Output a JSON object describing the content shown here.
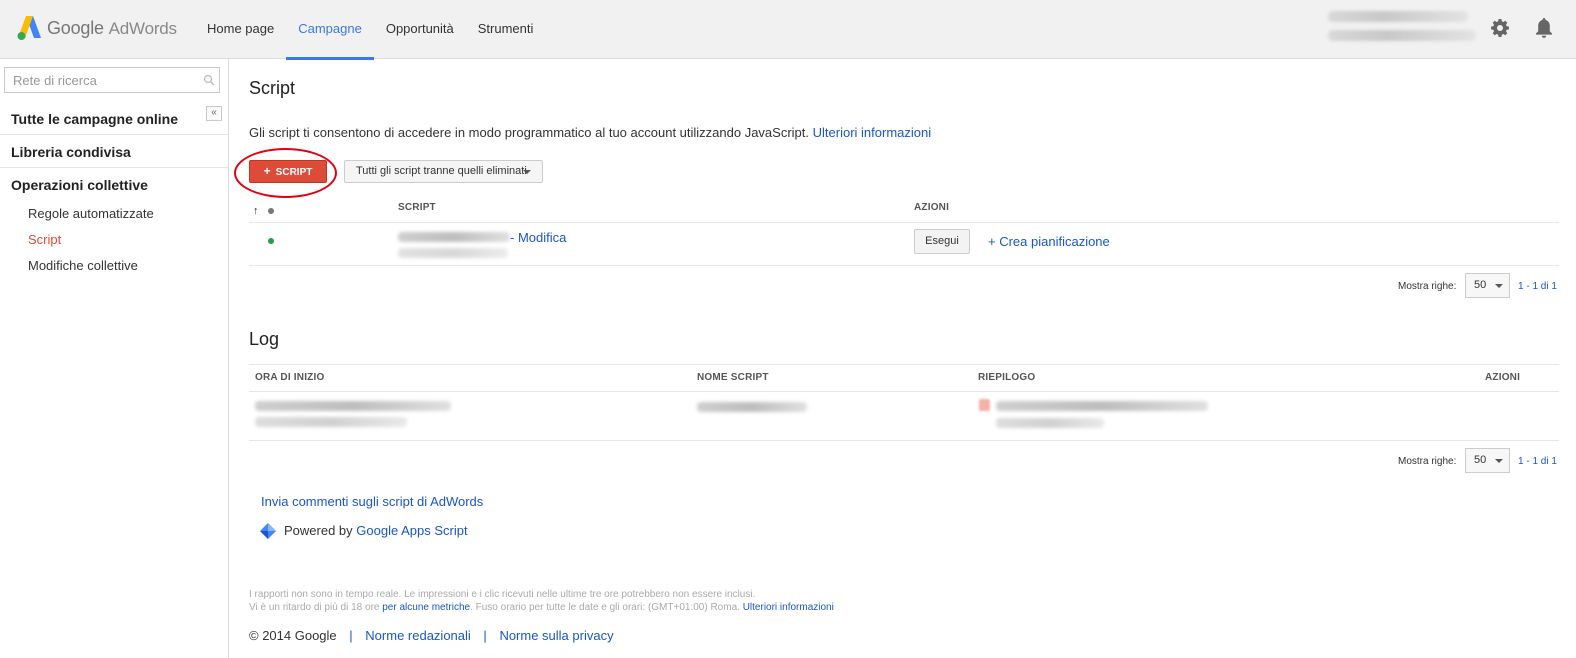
{
  "app": {
    "brand_google": "Google",
    "brand_adwords": "AdWords"
  },
  "topnav": {
    "tabs": [
      {
        "label": "Home page",
        "active": false
      },
      {
        "label": "Campagne",
        "active": true
      },
      {
        "label": "Opportunità",
        "active": false
      },
      {
        "label": "Strumenti",
        "active": false
      }
    ]
  },
  "sidebar": {
    "search_placeholder": "Rete di ricerca",
    "collapse_label": "«",
    "sections": [
      {
        "label": "Tutte le campagne online"
      },
      {
        "label": "Libreria condivisa"
      },
      {
        "label": "Operazioni collettive"
      }
    ],
    "subitems": [
      {
        "label": "Regole automatizzate",
        "active": false
      },
      {
        "label": "Script",
        "active": true
      },
      {
        "label": "Modifiche collettive",
        "active": false
      }
    ]
  },
  "scripts": {
    "title": "Script",
    "description": "Gli script ti consentono di accedere in modo programmatico al tuo account utilizzando JavaScript.",
    "more_info": "Ulteriori informazioni",
    "new_button": "SCRIPT",
    "new_button_icon": "+",
    "filter_label": "Tutti gli script tranne quelli eliminati",
    "sort_arrow": "↑",
    "columns": [
      "SCRIPT",
      "AZIONI"
    ],
    "row": {
      "edit_link": "- Modifica",
      "run_button": "Esegui",
      "schedule_link": "+ Crea pianificazione"
    },
    "rows_label": "Mostra righe:",
    "rows_value": "50",
    "range": "1 - 1 di 1"
  },
  "log": {
    "title": "Log",
    "columns": [
      "ORA DI INIZIO",
      "NOME SCRIPT",
      "RIEPILOGO",
      "AZIONI"
    ],
    "rows_label": "Mostra righe:",
    "rows_value": "50",
    "range": "1 - 1 di 1"
  },
  "links": {
    "feedback": "Invia commenti sugli script di AdWords",
    "powered_prefix": "Powered by",
    "powered_link": "Google Apps Script"
  },
  "footnote": {
    "line1": "I rapporti non sono in tempo reale. Le impressioni e i clic ricevuti nelle ultime tre ore potrebbero non essere inclusi.",
    "line2_a": "Vi è un ritardo di più di 18 ore",
    "line2_link1": "per alcune metriche",
    "line2_b": ". Fuso orario per tutte le date e gli orari: (GMT+01:00) Roma.",
    "line2_link2": "Ulteriori informazioni"
  },
  "footer": {
    "copyright": "© 2014 Google",
    "sep": "|",
    "link1": "Norme redazionali",
    "link2": "Norme sulla privacy"
  },
  "colors": {
    "accent_blue": "#3b78e7",
    "link_blue": "#1a55cc",
    "red_button": "#dd4b39",
    "status_green": "#23a043"
  }
}
